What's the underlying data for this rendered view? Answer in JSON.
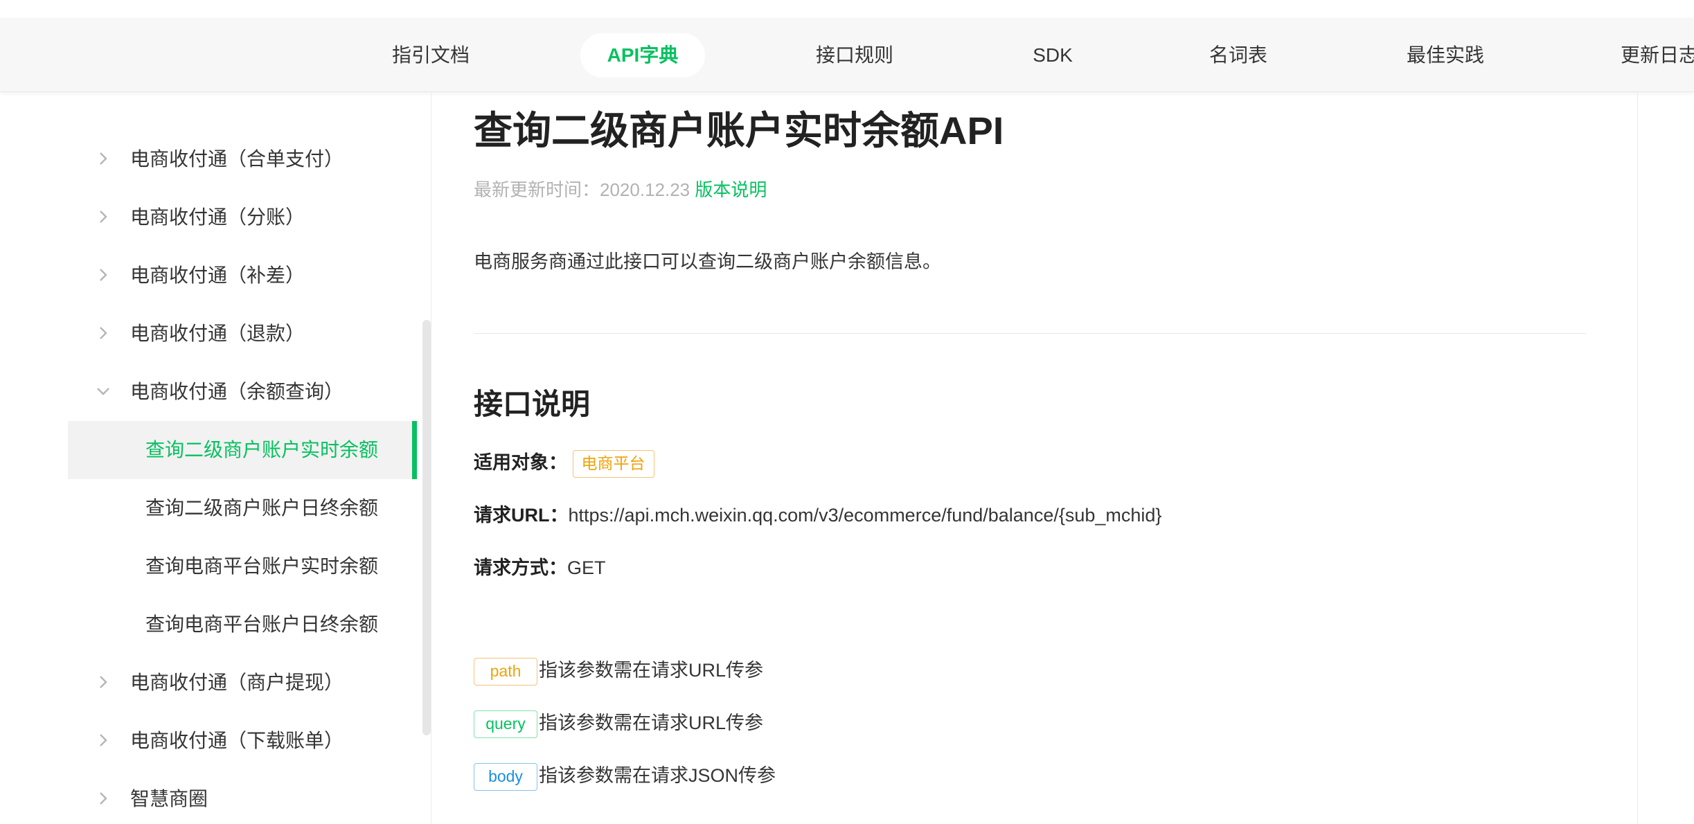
{
  "topnav": {
    "items": [
      {
        "label": "指引文档"
      },
      {
        "label": "API字典"
      },
      {
        "label": "接口规则"
      },
      {
        "label": "SDK"
      },
      {
        "label": "名词表"
      },
      {
        "label": "最佳实践"
      },
      {
        "label": "更新日志"
      }
    ],
    "active_index": 1
  },
  "sidebar": {
    "items": [
      {
        "label": "电商收付通（合单支付）",
        "expanded": false
      },
      {
        "label": "电商收付通（分账）",
        "expanded": false
      },
      {
        "label": "电商收付通（补差）",
        "expanded": false
      },
      {
        "label": "电商收付通（退款）",
        "expanded": false
      },
      {
        "label": "电商收付通（余额查询）",
        "expanded": true
      },
      {
        "label": "查询二级商户账户实时余额",
        "sub": true,
        "active": true
      },
      {
        "label": "查询二级商户账户日终余额",
        "sub": true
      },
      {
        "label": "查询电商平台账户实时余额",
        "sub": true
      },
      {
        "label": "查询电商平台账户日终余额",
        "sub": true
      },
      {
        "label": "电商收付通（商户提现）",
        "expanded": false
      },
      {
        "label": "电商收付通（下载账单）",
        "expanded": false
      },
      {
        "label": "智慧商圈",
        "expanded": false
      }
    ]
  },
  "main": {
    "title": "查询二级商户账户实时余额API",
    "update_prefix": "最新更新时间：2020.12.23",
    "version_link": "版本说明",
    "description": "电商服务商通过此接口可以查询二级商户账户余额信息。",
    "section_title": "接口说明",
    "applies_label": "适用对象：",
    "applies_tag": "电商平台",
    "url_label": "请求URL：",
    "url_value": "https://api.mch.weixin.qq.com/v3/ecommerce/fund/balance/{sub_mchid}",
    "method_label": "请求方式：",
    "method_value": "GET",
    "legend": [
      {
        "tag": "path",
        "text": "指该参数需在请求URL传参",
        "color": "#f0a30a"
      },
      {
        "tag": "query",
        "text": "指该参数需在请求URL传参",
        "color": "#07c160"
      },
      {
        "tag": "body",
        "text": "指该参数需在请求JSON传参",
        "color": "#1a8fe3"
      }
    ]
  },
  "colors": {
    "accent": "#07c160",
    "tag_orange": "#f0a30a",
    "tag_blue": "#1a8fe3"
  }
}
